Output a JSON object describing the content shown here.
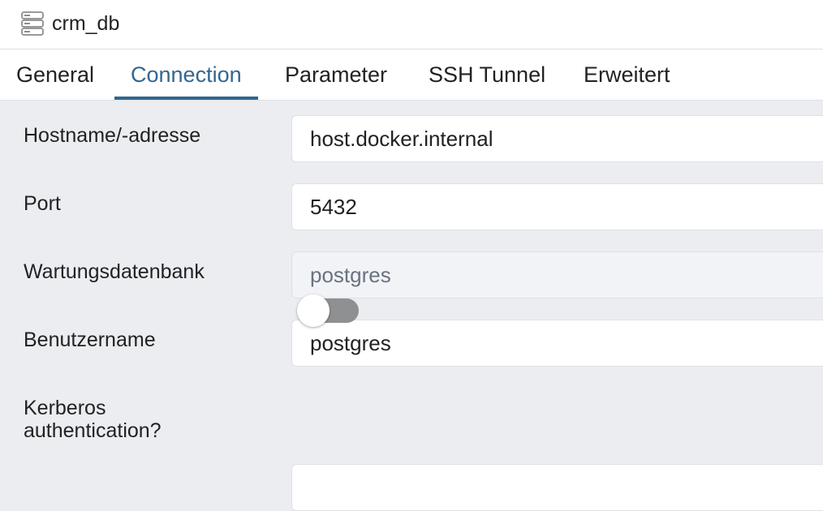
{
  "window": {
    "title": "crm_db",
    "icon": "server-icon"
  },
  "tabs": [
    {
      "label": "General",
      "active": false
    },
    {
      "label": "Connection",
      "active": true
    },
    {
      "label": "Parameter",
      "active": false
    },
    {
      "label": "SSH Tunnel",
      "active": false
    },
    {
      "label": "Erweitert",
      "active": false
    }
  ],
  "form": {
    "hostname": {
      "label": "Hostname/-adresse",
      "value": "host.docker.internal"
    },
    "port": {
      "label": "Port",
      "value": "5432"
    },
    "maintenance_db": {
      "label": "Wartungsdatenbank",
      "value": "postgres",
      "disabled": true
    },
    "username": {
      "label": "Benutzername",
      "value": "postgres"
    },
    "kerberos": {
      "label_line1": "Kerberos",
      "label_line2": "authentication?",
      "enabled": false
    }
  },
  "colors": {
    "accent": "#326690",
    "background": "#ebedf1",
    "toggle_off": "#8f9092"
  }
}
